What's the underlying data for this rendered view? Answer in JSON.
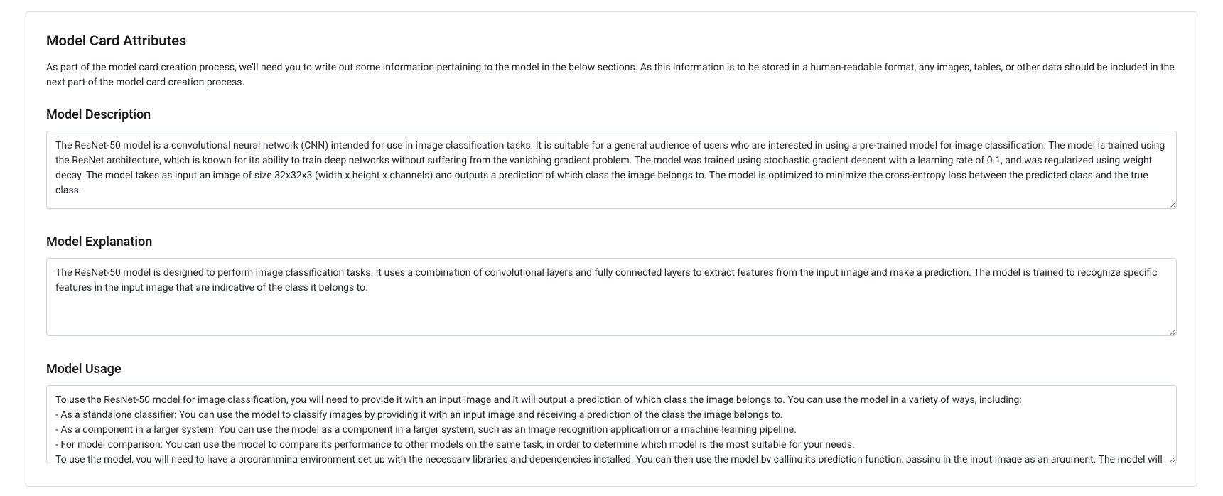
{
  "attributes": {
    "title": "Model Card Attributes",
    "intro": "As part of the model card creation process, we'll need you to write out some information pertaining to the model in the below sections. As this information is to be stored in a human-readable format, any images, tables, or other data should be included in the next part of the model card creation process."
  },
  "description": {
    "title": "Model Description",
    "value": "The ResNet-50 model is a convolutional neural network (CNN) intended for use in image classification tasks. It is suitable for a general audience of users who are interested in using a pre-trained model for image classification. The model is trained using the ResNet architecture, which is known for its ability to train deep networks without suffering from the vanishing gradient problem. The model was trained using stochastic gradient descent with a learning rate of 0.1, and was regularized using weight decay. The model takes as input an image of size 32x32x3 (width x height x channels) and outputs a prediction of which class the image belongs to. The model is optimized to minimize the cross-entropy loss between the predicted class and the true class."
  },
  "explanation": {
    "title": "Model Explanation",
    "value": "The ResNet-50 model is designed to perform image classification tasks. It uses a combination of convolutional layers and fully connected layers to extract features from the input image and make a prediction. The model is trained to recognize specific features in the input image that are indicative of the class it belongs to."
  },
  "usage": {
    "title": "Model Usage",
    "value": "To use the ResNet-50 model for image classification, you will need to provide it with an input image and it will output a prediction of which class the image belongs to. You can use the model in a variety of ways, including:\n- As a standalone classifier: You can use the model to classify images by providing it with an input image and receiving a prediction of the class the image belongs to.\n- As a component in a larger system: You can use the model as a component in a larger system, such as an image recognition application or a machine learning pipeline.\n- For model comparison: You can use the model to compare its performance to other models on the same task, in order to determine which model is the most suitable for your needs.\nTo use the model, you will need to have a programming environment set up with the necessary libraries and dependencies installed. You can then use the model by calling its prediction function, passing in the input image as an argument. The model will return a prediction of the class the image belongs to."
  }
}
